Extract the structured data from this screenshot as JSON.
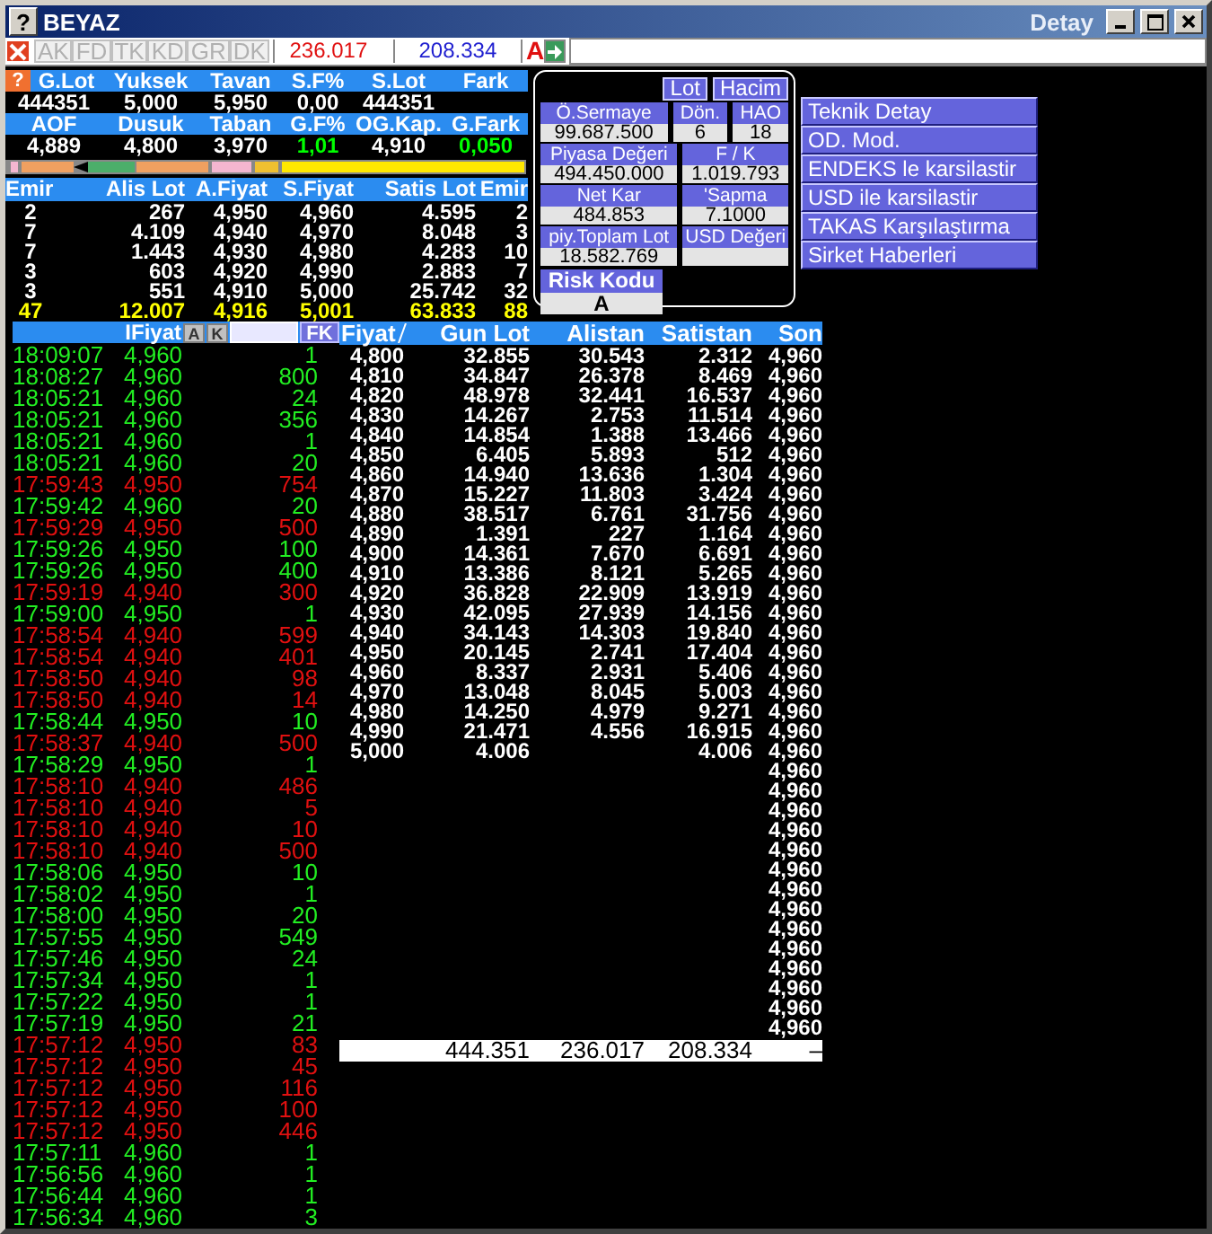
{
  "window": {
    "help_label": "?",
    "title": "BEYAZ",
    "detail_label": "Detay"
  },
  "toolbar": {
    "tabs": [
      {
        "label": "AK",
        "disabled": true
      },
      {
        "label": "FD",
        "disabled": true
      },
      {
        "label": "TK",
        "disabled": true
      },
      {
        "label": "KD",
        "disabled": true
      },
      {
        "label": "GR",
        "disabled": true
      },
      {
        "label": "DK",
        "disabled": true
      }
    ],
    "value_1": "236.017",
    "value_2": "208.334",
    "flag": "A"
  },
  "summary": {
    "help_label": "?",
    "rows": [
      {
        "kind": "header",
        "cells": [
          {
            "text": "G.Lot"
          },
          {
            "text": "Yuksek"
          },
          {
            "text": "Tavan"
          },
          {
            "text": "S.F%"
          },
          {
            "text": "S.Lot"
          },
          {
            "text": "Fark"
          }
        ]
      },
      {
        "kind": "data",
        "cells": [
          {
            "text": "444351"
          },
          {
            "text": "5,000"
          },
          {
            "text": "5,950"
          },
          {
            "text": "0,00"
          },
          {
            "text": "444351"
          }
        ]
      },
      {
        "kind": "header",
        "cells": [
          {
            "text": "AOF"
          },
          {
            "text": "Dusuk"
          },
          {
            "text": "Taban"
          },
          {
            "text": "G.F%"
          },
          {
            "text": "OG.Kap."
          },
          {
            "text": "G.Fark"
          }
        ]
      },
      {
        "kind": "data",
        "cells": [
          {
            "text": "4,889"
          },
          {
            "text": "4,800"
          },
          {
            "text": "3,970"
          },
          {
            "text": "1,01",
            "color": "#00ff00"
          },
          {
            "text": "4,910"
          },
          {
            "text": "0,050",
            "color": "#00ff00"
          }
        ]
      }
    ]
  },
  "depth": {
    "columns": [
      "Emir",
      "Alis Lot",
      "A.Fiyat",
      "S.Fiyat",
      "Satis Lot",
      "Emir"
    ],
    "rows": [
      [
        "2",
        "267",
        "4,950",
        "4,960",
        "4.595",
        "2"
      ],
      [
        "7",
        "4.109",
        "4,940",
        "4,970",
        "8.048",
        "3"
      ],
      [
        "7",
        "1.443",
        "4,930",
        "4,980",
        "4.283",
        "10"
      ],
      [
        "3",
        "603",
        "4,920",
        "4,990",
        "2.883",
        "7"
      ],
      [
        "3",
        "551",
        "4,910",
        "5,000",
        "25.742",
        "32"
      ]
    ],
    "total": [
      "47",
      "12.007",
      "4,916",
      "5,001",
      "63.833",
      "88"
    ]
  },
  "info": {
    "buttons": [
      "Lot",
      "Hacim"
    ],
    "rows": [
      [
        {
          "label": "Ö.Sermaye",
          "value": "99.687.500"
        },
        {
          "label": "Dön.",
          "value": "6"
        },
        {
          "label": "HAO",
          "value": "18"
        }
      ],
      [
        {
          "label": "Piyasa Değeri",
          "value": "494.450.000"
        },
        {
          "label": "F / K",
          "value": "1.019.793"
        }
      ],
      [
        {
          "label": "Net Kar",
          "value": "484.853"
        },
        {
          "label": "'Sapma",
          "value": "7.1000"
        }
      ],
      [
        {
          "label": "piy.Toplam Lot",
          "value": "18.582.769"
        },
        {
          "label": "USD Değeri"
        }
      ]
    ],
    "risk": {
      "label": "Risk Kodu",
      "value": "A"
    }
  },
  "links": [
    "Teknik Detay",
    "OD. Mod.",
    "ENDEKS le karsilastir",
    "USD ile karsilastir",
    "TAKAS Karşılaştırma",
    "Sirket Haberleri"
  ],
  "trades": {
    "header": {
      "label": "IFiyat",
      "buttons": [
        "A",
        "K"
      ],
      "action": "FK"
    },
    "rows": [
      {
        "time": "18:09:07",
        "price": "4,960",
        "lot": "1",
        "rising": true
      },
      {
        "time": "18:08:27",
        "price": "4,960",
        "lot": "800",
        "rising": true
      },
      {
        "time": "18:05:21",
        "price": "4,960",
        "lot": "24",
        "rising": true
      },
      {
        "time": "18:05:21",
        "price": "4,960",
        "lot": "356",
        "rising": true
      },
      {
        "time": "18:05:21",
        "price": "4,960",
        "lot": "1",
        "rising": true
      },
      {
        "time": "18:05:21",
        "price": "4,960",
        "lot": "20",
        "rising": true
      },
      {
        "time": "17:59:43",
        "price": "4,950",
        "lot": "754",
        "rising": false
      },
      {
        "time": "17:59:42",
        "price": "4,960",
        "lot": "20",
        "rising": true
      },
      {
        "time": "17:59:29",
        "price": "4,950",
        "lot": "500",
        "rising": false
      },
      {
        "time": "17:59:26",
        "price": "4,950",
        "lot": "100",
        "rising": true
      },
      {
        "time": "17:59:26",
        "price": "4,950",
        "lot": "400",
        "rising": true
      },
      {
        "time": "17:59:19",
        "price": "4,940",
        "lot": "300",
        "rising": false
      },
      {
        "time": "17:59:00",
        "price": "4,950",
        "lot": "1",
        "rising": true
      },
      {
        "time": "17:58:54",
        "price": "4,940",
        "lot": "599",
        "rising": false
      },
      {
        "time": "17:58:54",
        "price": "4,940",
        "lot": "401",
        "rising": false
      },
      {
        "time": "17:58:50",
        "price": "4,940",
        "lot": "98",
        "rising": false
      },
      {
        "time": "17:58:50",
        "price": "4,940",
        "lot": "14",
        "rising": false
      },
      {
        "time": "17:58:44",
        "price": "4,950",
        "lot": "10",
        "rising": true
      },
      {
        "time": "17:58:37",
        "price": "4,940",
        "lot": "500",
        "rising": false
      },
      {
        "time": "17:58:29",
        "price": "4,950",
        "lot": "1",
        "rising": true
      },
      {
        "time": "17:58:10",
        "price": "4,940",
        "lot": "486",
        "rising": false
      },
      {
        "time": "17:58:10",
        "price": "4,940",
        "lot": "5",
        "rising": false
      },
      {
        "time": "17:58:10",
        "price": "4,940",
        "lot": "10",
        "rising": false
      },
      {
        "time": "17:58:10",
        "price": "4,940",
        "lot": "500",
        "rising": false
      },
      {
        "time": "17:58:06",
        "price": "4,950",
        "lot": "10",
        "rising": true
      },
      {
        "time": "17:58:02",
        "price": "4,950",
        "lot": "1",
        "rising": true
      },
      {
        "time": "17:58:00",
        "price": "4,950",
        "lot": "20",
        "rising": true
      },
      {
        "time": "17:57:55",
        "price": "4,950",
        "lot": "549",
        "rising": true
      },
      {
        "time": "17:57:46",
        "price": "4,950",
        "lot": "24",
        "rising": true
      },
      {
        "time": "17:57:34",
        "price": "4,950",
        "lot": "1",
        "rising": true
      },
      {
        "time": "17:57:22",
        "price": "4,950",
        "lot": "1",
        "rising": true
      },
      {
        "time": "17:57:19",
        "price": "4,950",
        "lot": "21",
        "rising": true
      },
      {
        "time": "17:57:12",
        "price": "4,950",
        "lot": "83",
        "rising": false
      },
      {
        "time": "17:57:12",
        "price": "4,950",
        "lot": "45",
        "rising": false
      },
      {
        "time": "17:57:12",
        "price": "4,950",
        "lot": "116",
        "rising": false
      },
      {
        "time": "17:57:12",
        "price": "4,950",
        "lot": "100",
        "rising": false
      },
      {
        "time": "17:57:12",
        "price": "4,950",
        "lot": "446",
        "rising": false
      },
      {
        "time": "17:57:11",
        "price": "4,960",
        "lot": "1",
        "rising": true
      },
      {
        "time": "17:56:56",
        "price": "4,960",
        "lot": "1",
        "rising": true
      },
      {
        "time": "17:56:44",
        "price": "4,960",
        "lot": "1",
        "rising": true
      },
      {
        "time": "17:56:34",
        "price": "4,960",
        "lot": "3",
        "rising": true
      }
    ]
  },
  "price_table": {
    "columns": [
      "Fiyat",
      "Gun Lot",
      "Alistan",
      "Satistan",
      "Son"
    ],
    "rows": [
      {
        "fiyat": "4,800",
        "gun_lot": "32.855",
        "alistan": "30.543",
        "satistan": "2.312",
        "son": "4,960"
      },
      {
        "fiyat": "4,810",
        "gun_lot": "34.847",
        "alistan": "26.378",
        "satistan": "8.469",
        "son": "4,960"
      },
      {
        "fiyat": "4,820",
        "gun_lot": "48.978",
        "alistan": "32.441",
        "satistan": "16.537",
        "son": "4,960"
      },
      {
        "fiyat": "4,830",
        "gun_lot": "14.267",
        "alistan": "2.753",
        "satistan": "11.514",
        "son": "4,960"
      },
      {
        "fiyat": "4,840",
        "gun_lot": "14.854",
        "alistan": "1.388",
        "satistan": "13.466",
        "son": "4,960"
      },
      {
        "fiyat": "4,850",
        "gun_lot": "6.405",
        "alistan": "5.893",
        "satistan": "512",
        "son": "4,960"
      },
      {
        "fiyat": "4,860",
        "gun_lot": "14.940",
        "alistan": "13.636",
        "satistan": "1.304",
        "son": "4,960"
      },
      {
        "fiyat": "4,870",
        "gun_lot": "15.227",
        "alistan": "11.803",
        "satistan": "3.424",
        "son": "4,960"
      },
      {
        "fiyat": "4,880",
        "gun_lot": "38.517",
        "alistan": "6.761",
        "satistan": "31.756",
        "son": "4,960"
      },
      {
        "fiyat": "4,890",
        "gun_lot": "1.391",
        "alistan": "227",
        "satistan": "1.164",
        "son": "4,960"
      },
      {
        "fiyat": "4,900",
        "gun_lot": "14.361",
        "alistan": "7.670",
        "satistan": "6.691",
        "son": "4,960"
      },
      {
        "fiyat": "4,910",
        "gun_lot": "13.386",
        "alistan": "8.121",
        "satistan": "5.265",
        "son": "4,960"
      },
      {
        "fiyat": "4,920",
        "gun_lot": "36.828",
        "alistan": "22.909",
        "satistan": "13.919",
        "son": "4,960"
      },
      {
        "fiyat": "4,930",
        "gun_lot": "42.095",
        "alistan": "27.939",
        "satistan": "14.156",
        "son": "4,960"
      },
      {
        "fiyat": "4,940",
        "gun_lot": "34.143",
        "alistan": "14.303",
        "satistan": "19.840",
        "son": "4,960"
      },
      {
        "fiyat": "4,950",
        "gun_lot": "20.145",
        "alistan": "2.741",
        "satistan": "17.404",
        "son": "4,960"
      },
      {
        "fiyat": "4,960",
        "gun_lot": "8.337",
        "alistan": "2.931",
        "satistan": "5.406",
        "son": "4,960"
      },
      {
        "fiyat": "4,970",
        "gun_lot": "13.048",
        "alistan": "8.045",
        "satistan": "5.003",
        "son": "4,960"
      },
      {
        "fiyat": "4,980",
        "gun_lot": "14.250",
        "alistan": "4.979",
        "satistan": "9.271",
        "son": "4,960"
      },
      {
        "fiyat": "4,990",
        "gun_lot": "21.471",
        "alistan": "4.556",
        "satistan": "16.915",
        "son": "4,960"
      },
      {
        "fiyat": "5,000",
        "gun_lot": "4.006",
        "satistan": "4.006",
        "son": "4,960"
      },
      {
        "son": "4,960"
      },
      {
        "son": "4,960"
      },
      {
        "son": "4,960"
      },
      {
        "son": "4,960"
      },
      {
        "son": "4,960"
      },
      {
        "son": "4,960"
      },
      {
        "son": "4,960"
      },
      {
        "son": "4,960"
      },
      {
        "son": "4,960"
      },
      {
        "son": "4,960"
      },
      {
        "son": "4,960"
      },
      {
        "son": "4,960"
      },
      {
        "son": "4,960"
      },
      {
        "son": "4,960"
      }
    ],
    "total": {
      "gun_lot": "444.351",
      "alistan": "236.017",
      "satistan": "208.334",
      "son": "–"
    }
  }
}
